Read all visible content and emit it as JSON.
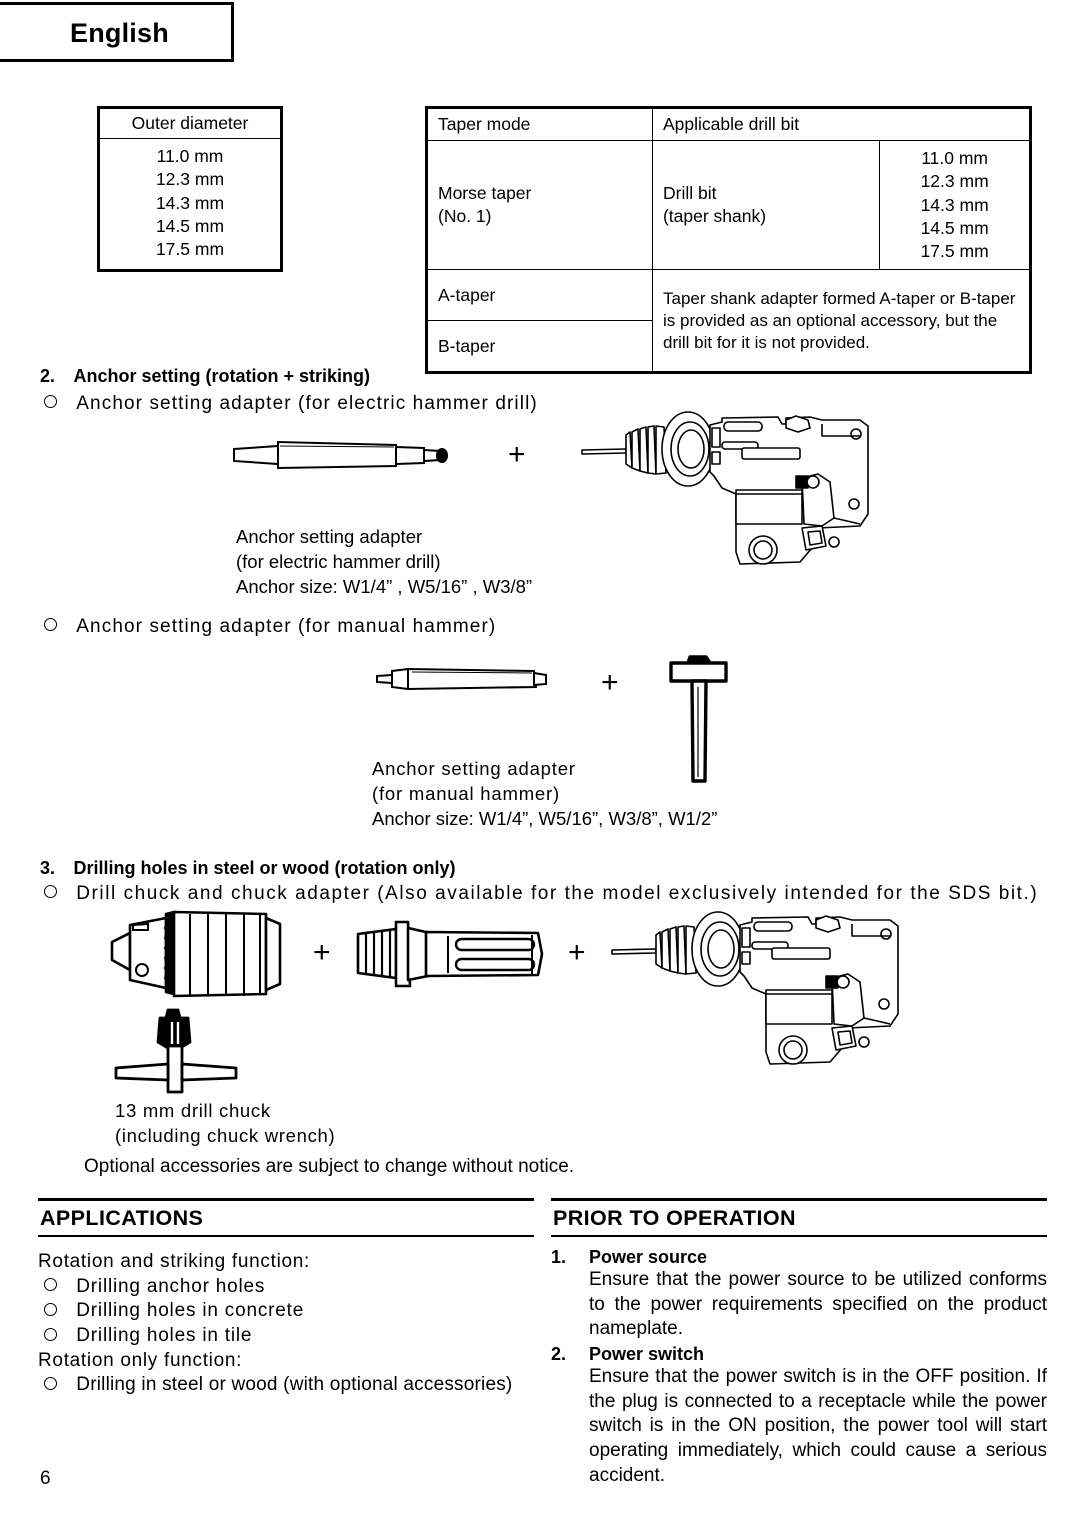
{
  "header": {
    "language": "English"
  },
  "page_number": "6",
  "table_outer_diameter": {
    "header": "Outer diameter",
    "values": [
      "11.0 mm",
      "12.3 mm",
      "14.3 mm",
      "14.5 mm",
      "17.5 mm"
    ]
  },
  "table_taper": {
    "headers": [
      "Taper mode",
      "Applicable drill bit"
    ],
    "row_morse": {
      "mode": "Morse taper\n(No. 1)",
      "bit": "Drill bit\n(taper shank)",
      "sizes": [
        "11.0 mm",
        "12.3 mm",
        "14.3 mm",
        "14.5 mm",
        "17.5 mm"
      ]
    },
    "row_a_taper": {
      "mode": "A-taper"
    },
    "row_b_taper": {
      "mode": "B-taper"
    },
    "taper_note": "Taper shank adapter formed A-taper or B-taper is provided as an optional accessory, but the drill bit for it is not provided."
  },
  "section2": {
    "number": "2.",
    "title": "Anchor setting (rotation + striking)",
    "item1": "Anchor setting adapter (for electric hammer drill)",
    "caption1_line1": "Anchor setting adapter",
    "caption1_line2": "(for electric hammer drill)",
    "caption1_line3": "Anchor size: W1/4” , W5/16” , W3/8”",
    "item2": "Anchor setting adapter (for manual hammer)",
    "caption2_line1": "Anchor setting adapter",
    "caption2_line2": "(for manual hammer)",
    "caption2_line3": "Anchor size: W1/4”, W5/16”, W3/8”, W1/2”",
    "plus": "+"
  },
  "section3": {
    "number": "3.",
    "title": "Drilling holes in steel or wood (rotation only)",
    "item1": "Drill chuck and chuck adapter (Also available for the model exclusively intended for the SDS bit.)",
    "caption_line1": "13 mm drill chuck",
    "caption_line2": "(including chuck wrench)",
    "plus": "+"
  },
  "notice": "Optional accessories are subject to change without notice.",
  "applications": {
    "heading": "APPLICATIONS",
    "group1_label": "Rotation and striking function:",
    "group1_items": [
      "Drilling anchor holes",
      "Drilling holes in concrete",
      "Drilling holes in tile"
    ],
    "group2_label": "Rotation only function:",
    "group2_items": [
      "Drilling in steel or wood (with optional accessories)"
    ]
  },
  "prior_to_operation": {
    "heading": "PRIOR TO OPERATION",
    "items": [
      {
        "number": "1.",
        "title": "Power source",
        "body": "Ensure that the power source to be utilized conforms to the power requirements specified on the product nameplate."
      },
      {
        "number": "2.",
        "title": "Power switch",
        "body": "Ensure that the power switch is in the OFF position. If the plug is connected to a receptacle while the power switch is in the ON position, the power tool will start operating immediately, which could cause a serious accident."
      }
    ]
  },
  "illustrations": {
    "hammer_drill": "hammer-drill-illustration",
    "anchor_rod": "anchor-setting-adapter-illustration",
    "manual_rod": "manual-anchor-adapter-illustration",
    "hand_hammer": "hand-hammer-illustration",
    "drill_chuck": "drill-chuck-illustration",
    "chuck_wrench": "chuck-wrench-illustration",
    "chuck_adapter": "sds-chuck-adapter-illustration"
  }
}
